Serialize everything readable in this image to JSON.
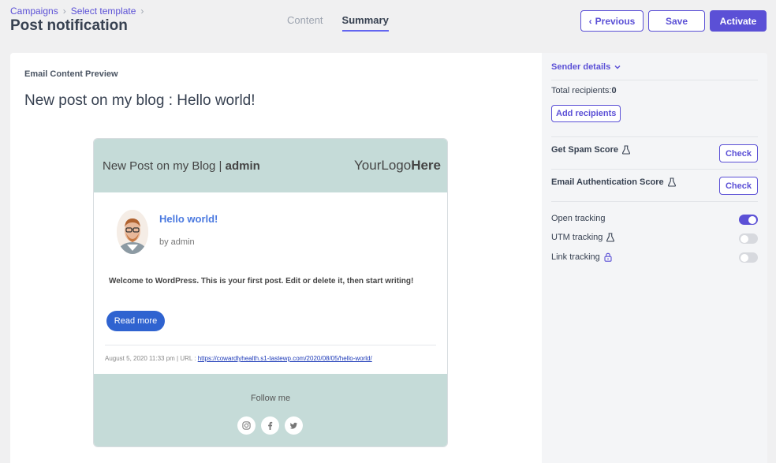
{
  "breadcrumb": {
    "items": [
      "Campaigns",
      "Select template"
    ],
    "separator": "›"
  },
  "page_title": "Post notification",
  "tabs": [
    {
      "label": "Content",
      "active": false
    },
    {
      "label": "Summary",
      "active": true
    }
  ],
  "actions": {
    "previous_label": "Previous",
    "previous_icon": "‹",
    "save_label": "Save",
    "activate_label": "Activate"
  },
  "preview": {
    "section_label": "Email Content Preview",
    "subject": "New post on my blog : Hello world!",
    "email": {
      "header_title_prefix": "New Post on my Blog | ",
      "header_title_bold": "admin",
      "logo_prefix": "YourLogo",
      "logo_bold": "Here",
      "post_title": "Hello world!",
      "post_by": "by admin",
      "excerpt": "Welcome to WordPress. This is your first post. Edit or delete it, then start writing!",
      "read_more": "Read more",
      "meta_text": "August 5, 2020 11:33 pm | URL : ",
      "meta_link": "https://cowardlyhealth.s1-tastewp.com/2020/08/05/hello-world/",
      "follow_label": "Follow me",
      "socials": [
        "instagram-icon",
        "facebook-icon",
        "twitter-icon"
      ]
    }
  },
  "sidebar": {
    "sender_details": "Sender details",
    "recipients_label": "Total recipients: ",
    "recipients_count": "0",
    "add_recipients": "Add recipients",
    "spam_label": "Get Spam Score",
    "auth_label": "Email Authentication Score",
    "check_label": "Check",
    "open_tracking": "Open tracking",
    "utm_tracking": "UTM tracking",
    "link_tracking": "Link tracking",
    "open_tracking_on": true,
    "utm_tracking_on": false,
    "link_tracking_on": false
  },
  "colors": {
    "accent": "#5b50d6",
    "email_header_bg": "#c5dbd8",
    "link": "#4a79e0"
  }
}
